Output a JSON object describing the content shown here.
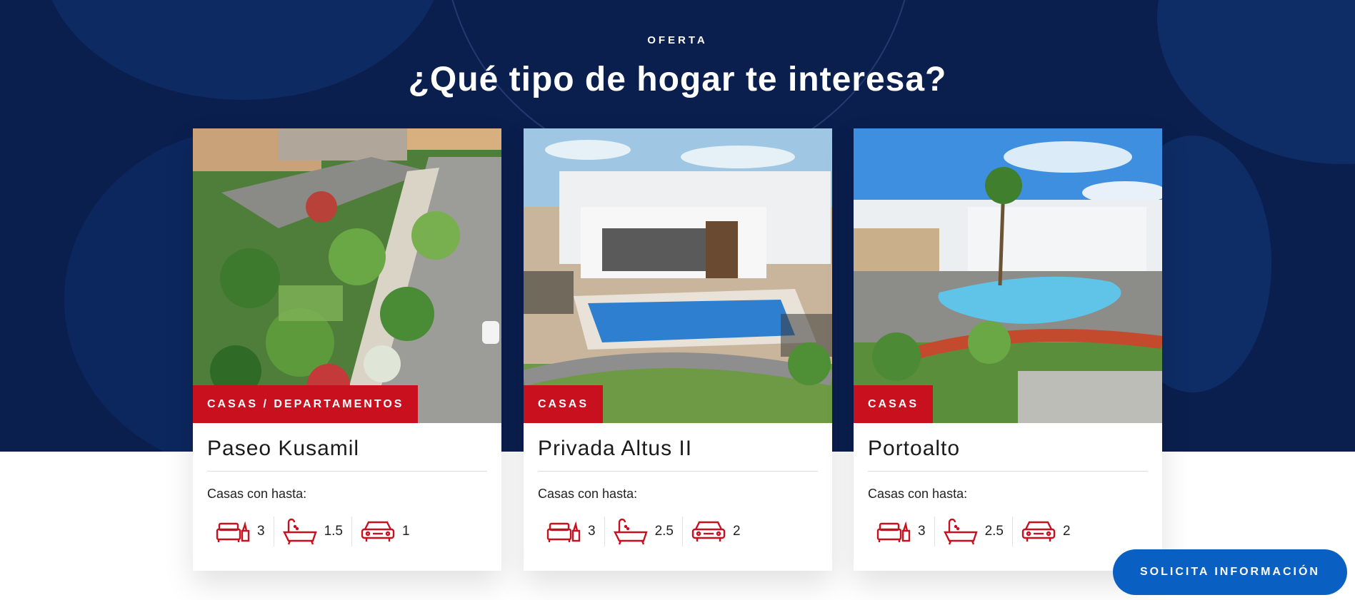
{
  "section": {
    "eyebrow": "OFERTA",
    "title": "¿Qué tipo de hogar te interesa?"
  },
  "cards": [
    {
      "badge": "CASAS / DEPARTAMENTOS",
      "name": "Paseo Kusamil",
      "subtitle": "Casas con hasta:",
      "bedrooms": "3",
      "bathrooms": "1.5",
      "parking": "1",
      "image": "aerial-park-render"
    },
    {
      "badge": "CASAS",
      "name": "Privada Altus II",
      "subtitle": "Casas con hasta:",
      "bedrooms": "3",
      "bathrooms": "2.5",
      "parking": "2",
      "image": "pool-clubhouse-render"
    },
    {
      "badge": "CASAS",
      "name": "Portoalto",
      "subtitle": "Casas con hasta:",
      "bedrooms": "3",
      "bathrooms": "2.5",
      "parking": "2",
      "image": "lagoon-pool-render"
    }
  ],
  "cta": {
    "label": "SOLICITA INFORMACIÓN"
  },
  "colors": {
    "navy": "#0b1f4f",
    "accent_red": "#c8101f",
    "cta_blue": "#0a5fc2"
  }
}
